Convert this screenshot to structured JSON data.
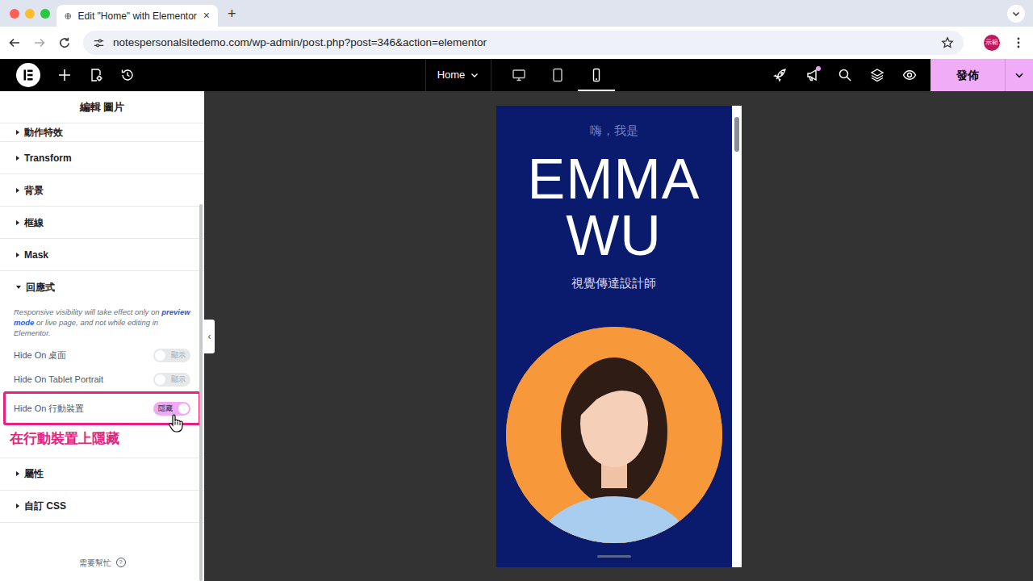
{
  "browser": {
    "tab": {
      "title": "Edit \"Home\" with Elementor",
      "close": "×",
      "selected": true
    },
    "new_tab": "+",
    "url": "notespersonalsitedemo.com/wp-admin/post.php?post=346&action=elementor",
    "profile": "示範"
  },
  "editor_bar": {
    "page": "Home",
    "devices": [
      {
        "kind": "desktop",
        "selected": false
      },
      {
        "kind": "tablet",
        "selected": false
      },
      {
        "kind": "mobile",
        "selected": true
      }
    ],
    "notifications_unread": true,
    "publish": "發佈"
  },
  "panel": {
    "title": "編輯 圖片",
    "sections": [
      {
        "label": "動作特效",
        "expanded": false
      },
      {
        "label": "Transform",
        "expanded": false
      },
      {
        "label": "背景",
        "expanded": false
      },
      {
        "label": "框線",
        "expanded": false
      },
      {
        "label": "Mask",
        "expanded": false
      },
      {
        "label": "回應式",
        "expanded": true,
        "body": {
          "note": {
            "before": "Responsive visibility will take effect only on ",
            "link": "preview mode",
            "after": " or live page, and not while editing in Elementor."
          },
          "toggles": [
            {
              "label": "Hide On 桌面",
              "state": "顯示",
              "on": false,
              "highlighted": false
            },
            {
              "label": "Hide On Tablet Portrait",
              "state": "顯示",
              "on": false,
              "highlighted": false
            },
            {
              "label": "Hide On 行動裝置",
              "state": "隱藏",
              "on": true,
              "highlighted": true
            }
          ],
          "annotation": "在行動裝置上隱藏"
        }
      },
      {
        "label": "屬性",
        "expanded": false
      },
      {
        "label": "自訂 CSS",
        "expanded": false
      }
    ],
    "help": {
      "label": "需要幫忙",
      "icon": "?"
    },
    "collapse": "‹"
  },
  "preview": {
    "greeting": "嗨，我是",
    "name_lines": [
      "EMMA",
      "WU"
    ],
    "role": "視覺傳達設計師"
  }
}
